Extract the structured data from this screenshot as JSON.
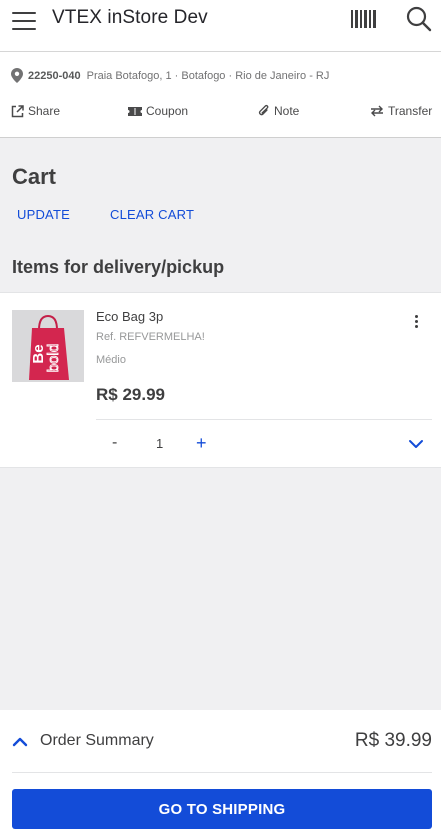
{
  "header": {
    "title": "VTEX inStore Dev",
    "menu_icon": "hamburger-menu-icon",
    "barcode_icon": "barcode-icon",
    "search_icon": "search-icon"
  },
  "address": {
    "zip": "22250-040",
    "street": "Praia Botafogo, 1 · Botafogo · Rio de Janeiro - RJ"
  },
  "actions": [
    {
      "label": "Share",
      "icon": "share-icon"
    },
    {
      "label": "Coupon",
      "icon": "coupon-icon"
    },
    {
      "label": "Note",
      "icon": "paperclip-icon"
    },
    {
      "label": "Transfer",
      "icon": "transfer-icon"
    }
  ],
  "cart": {
    "title": "Cart",
    "update_label": "UPDATE",
    "clear_label": "CLEAR CART",
    "section_title": "Items for delivery/pickup"
  },
  "item": {
    "name": "Eco Bag 3p",
    "ref": "Ref. REFVERMELHA!",
    "variant": "Médio",
    "price": "R$ 29.99",
    "quantity": "1",
    "minus": "-",
    "plus": "+",
    "bag_print": "Be bold"
  },
  "footer": {
    "summary_label": "Order Summary",
    "total": "R$ 39.99",
    "cta_label": "GO TO SHIPPING"
  },
  "colors": {
    "accent": "#134cd8",
    "background": "#f0f0f2",
    "text": "#3f3f40",
    "bag": "#d3264f"
  }
}
